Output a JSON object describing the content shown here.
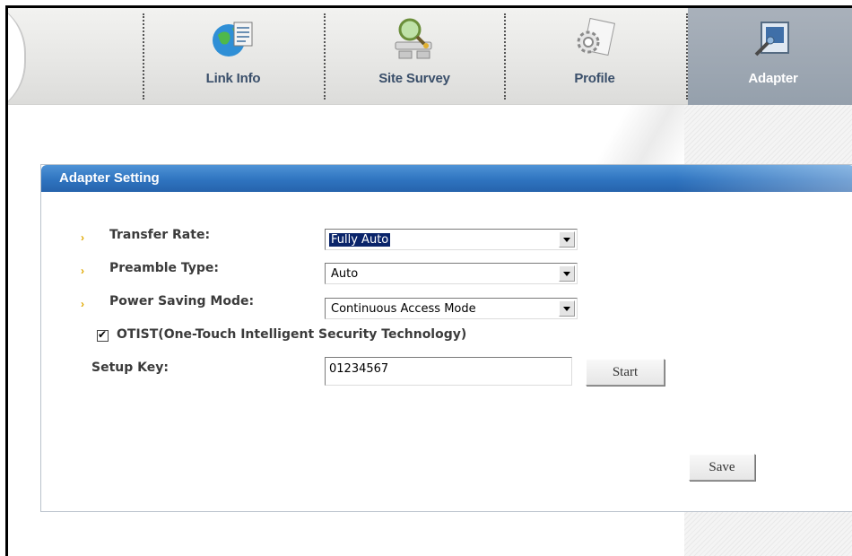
{
  "nav": {
    "tabs": [
      {
        "label": "Link Info",
        "icon": "globe-document-icon",
        "active": false
      },
      {
        "label": "Site Survey",
        "icon": "network-search-icon",
        "active": false
      },
      {
        "label": "Profile",
        "icon": "gear-page-icon",
        "active": false
      },
      {
        "label": "Adapter",
        "icon": "adapter-card-icon",
        "active": true
      }
    ]
  },
  "panel": {
    "title": "Adapter Setting"
  },
  "settings": {
    "transfer_rate": {
      "label": "Transfer Rate:",
      "value": "Fully Auto"
    },
    "preamble_type": {
      "label": "Preamble Type:",
      "value": "Auto"
    },
    "power_saving_mode": {
      "label": "Power Saving Mode:",
      "value": "Continuous Access Mode"
    },
    "otist": {
      "label": "OTIST(One-Touch Intelligent Security Technology)",
      "checked": true
    },
    "setup_key": {
      "label": "Setup Key:",
      "value": "01234567"
    }
  },
  "buttons": {
    "start_label": "Start",
    "save_label": "Save"
  },
  "colors": {
    "header_blue": "#2f74c0",
    "active_tab": "#95a0ac",
    "bullet": "#e0a800"
  }
}
